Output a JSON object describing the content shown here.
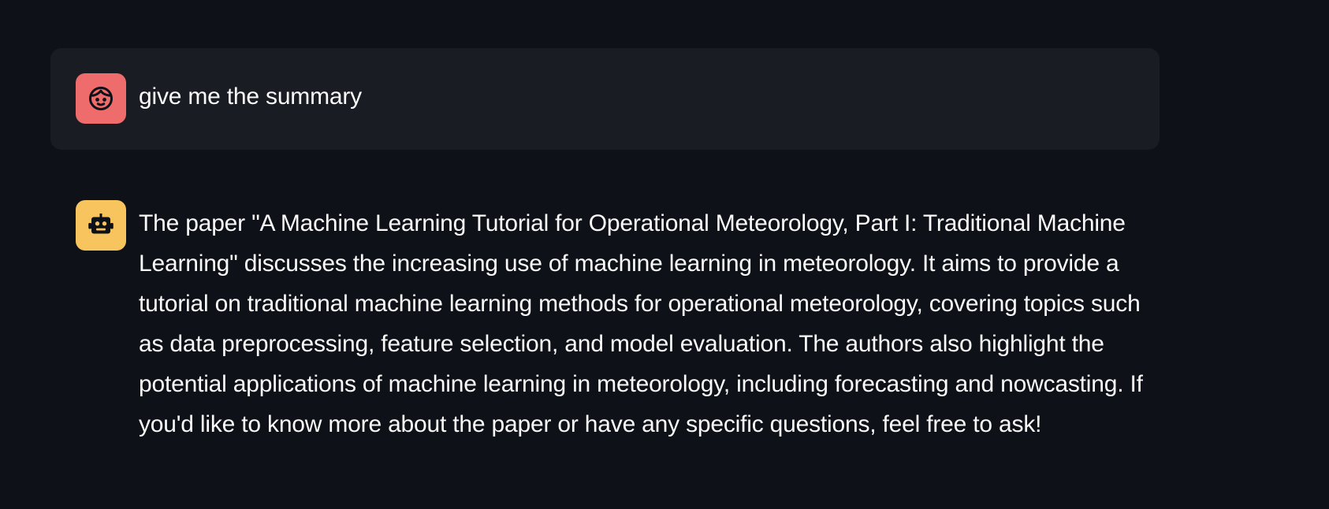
{
  "chat": {
    "messages": [
      {
        "role": "user",
        "avatar_icon": "user-face-icon",
        "avatar_color": "#ee6c6c",
        "text": "give me the summary"
      },
      {
        "role": "assistant",
        "avatar_icon": "robot-icon",
        "avatar_color": "#f8c45d",
        "text": "The paper \"A Machine Learning Tutorial for Operational Meteorology, Part I: Traditional Machine Learning\" discusses the increasing use of machine learning in meteorology. It aims to provide a tutorial on traditional machine learning methods for operational meteorology, covering topics such as data preprocessing, feature selection, and model evaluation. The authors also highlight the potential applications of machine learning in meteorology, including forecasting and nowcasting. If you'd like to know more about the paper or have any specific questions, feel free to ask!"
      }
    ]
  },
  "theme": {
    "background": "#0e1117",
    "user_bubble": "#1a1c24",
    "text": "#fafafa"
  }
}
